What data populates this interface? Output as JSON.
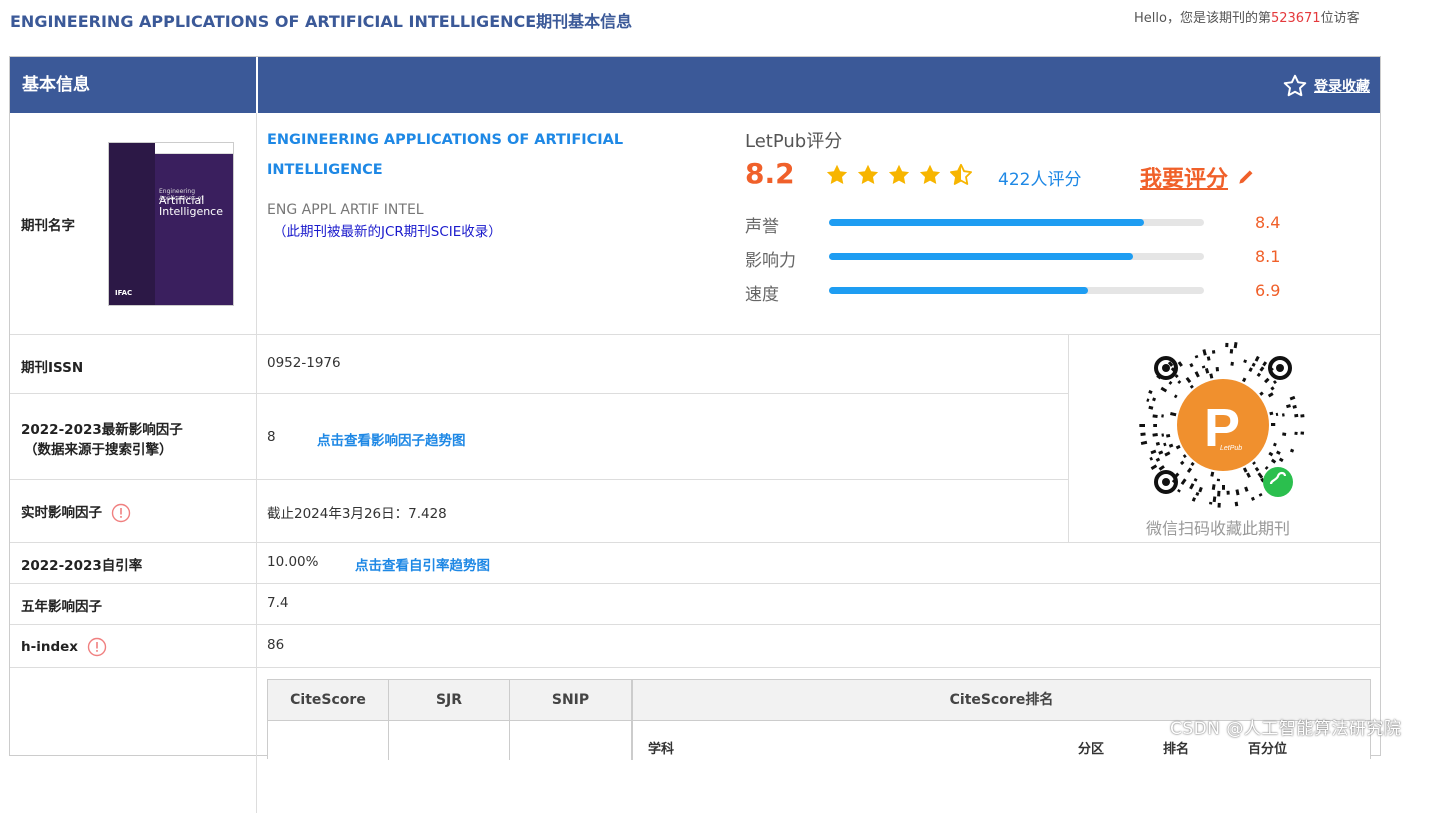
{
  "page": {
    "title": "ENGINEERING APPLICATIONS OF ARTIFICIAL INTELLIGENCE期刊基本信息",
    "visitor_prefix": "Hello，您是该期刊的第",
    "visitor_num": "523671",
    "visitor_suffix": "位访客"
  },
  "header": {
    "section": "基本信息",
    "login_fav": "登录收藏"
  },
  "journal": {
    "label": "期刊名字",
    "name": "ENGINEERING APPLICATIONS OF ARTIFICIAL INTELLIGENCE",
    "abbr": "ENG APPL ARTIF INTEL",
    "note": "（此期刊被最新的JCR期刊SCIE收录）",
    "cover_small": "Engineering Applications of",
    "cover_title": "Artificial Intelligence",
    "cover_publisher": "IFAC"
  },
  "letpub": {
    "title": "LetPub评分",
    "score": "8.2",
    "stars": 4.5,
    "count": "422人评分",
    "rate_me": "我要评分",
    "bars": [
      {
        "label": "声誉",
        "value": "8.4",
        "ratio": 0.84
      },
      {
        "label": "影响力",
        "value": "8.1",
        "ratio": 0.81
      },
      {
        "label": "速度",
        "value": "6.9",
        "ratio": 0.69
      }
    ]
  },
  "rows": {
    "issn_label": "期刊ISSN",
    "issn_value": "0952-1976",
    "if_label1": "2022-2023最新影响因子",
    "if_label2": "（数据来源于搜索引擎）",
    "if_value": "8",
    "if_link": "点击查看影响因子趋势图",
    "rt_label": "实时影响因子",
    "rt_value": "截止2024年3月26日：7.428",
    "sc_label": "2022-2023自引率",
    "sc_value": "10.00%",
    "sc_link": "点击查看自引率趋势图",
    "five_label": "五年影响因子",
    "five_value": "7.4",
    "h_label": "h-index",
    "h_value": "86"
  },
  "qr": {
    "caption": "微信扫码收藏此期刊",
    "brand": "LetPub"
  },
  "subtable": {
    "h_citescore": "CiteScore",
    "h_sjr": "SJR",
    "h_snip": "SNIP",
    "h_rank": "CiteScore排名",
    "c_subject": "学科",
    "c_zone": "分区",
    "c_rank": "排名",
    "c_pct": "百分位"
  },
  "watermark": "CSDN @人工智能算法研究院"
}
